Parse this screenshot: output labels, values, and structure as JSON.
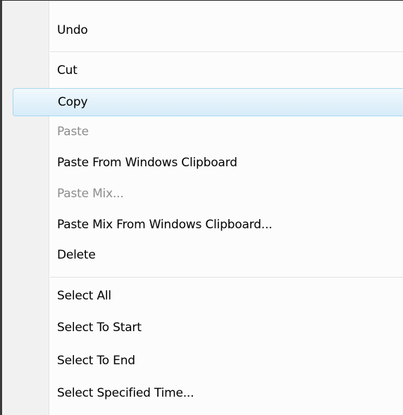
{
  "menu": {
    "items": [
      {
        "label": "Undo",
        "enabled": true,
        "highlighted": false
      },
      {
        "label": "Cut",
        "enabled": true,
        "highlighted": false
      },
      {
        "label": "Copy",
        "enabled": true,
        "highlighted": true
      },
      {
        "label": "Paste",
        "enabled": false,
        "highlighted": false
      },
      {
        "label": "Paste From Windows Clipboard",
        "enabled": true,
        "highlighted": false
      },
      {
        "label": "Paste Mix...",
        "enabled": false,
        "highlighted": false
      },
      {
        "label": "Paste Mix From Windows Clipboard...",
        "enabled": true,
        "highlighted": false
      },
      {
        "label": "Delete",
        "enabled": true,
        "highlighted": false
      },
      {
        "label": "Select All",
        "enabled": true,
        "highlighted": false
      },
      {
        "label": "Select To Start",
        "enabled": true,
        "highlighted": false
      },
      {
        "label": "Select To End",
        "enabled": true,
        "highlighted": false
      },
      {
        "label": "Select Specified Time...",
        "enabled": true,
        "highlighted": false
      }
    ]
  },
  "colors": {
    "highlight_border": "#a8d8f0",
    "disabled_text": "#8d8d8d",
    "gutter": "#f1f1f1"
  }
}
